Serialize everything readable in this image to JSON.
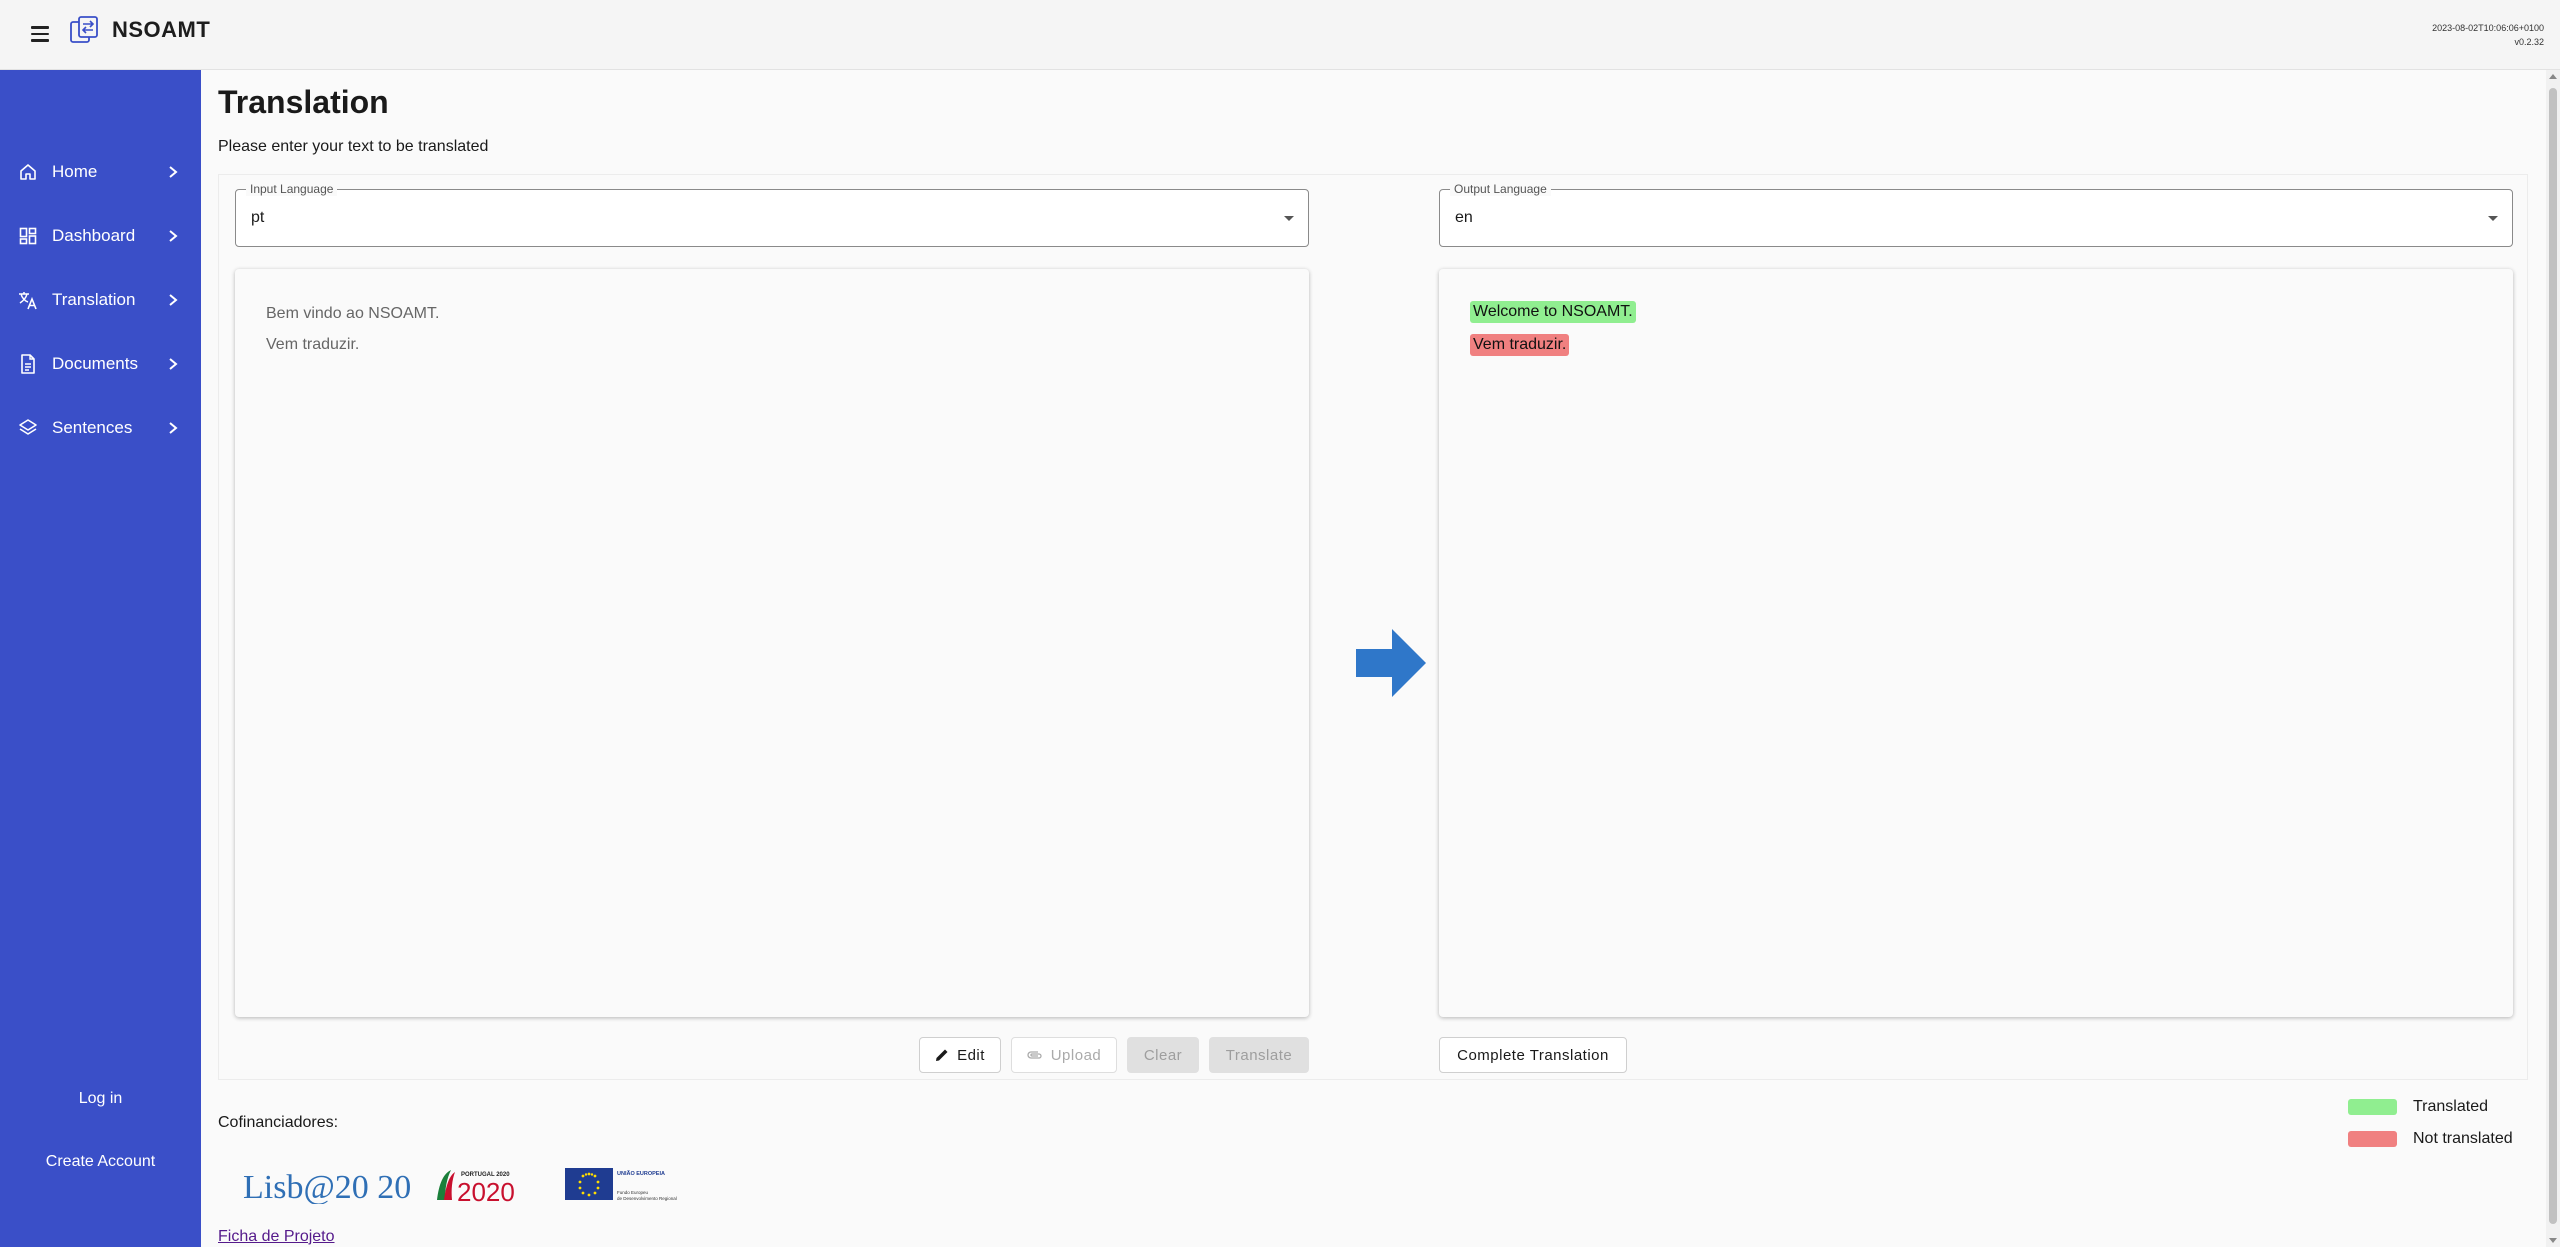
{
  "header": {
    "app_title": "NSOAMT",
    "build_timestamp": "2023-08-02T10:06:06+0100",
    "version": "v0.2.32",
    "menu_icon": "hamburger-menu-icon",
    "logo_icon": "translation-logo-icon"
  },
  "sidebar": {
    "items": [
      {
        "label": "Home",
        "icon": "home-icon"
      },
      {
        "label": "Dashboard",
        "icon": "dashboard-icon"
      },
      {
        "label": "Translation",
        "icon": "translate-icon"
      },
      {
        "label": "Documents",
        "icon": "document-icon"
      },
      {
        "label": "Sentences",
        "icon": "layers-icon"
      }
    ],
    "login": "Log in",
    "create_account": "Create Account",
    "background_color": "#3a4fc8"
  },
  "main": {
    "title": "Translation",
    "subtitle": "Please enter your text to be translated",
    "input_language": {
      "legend": "Input Language",
      "value": "pt"
    },
    "output_language": {
      "legend": "Output Language",
      "value": "en"
    },
    "source_lines": [
      "Bem vindo ao NSOAMT.",
      "Vem traduzir."
    ],
    "output_lines": [
      {
        "text": "Welcome to NSOAMT.",
        "status": "translated"
      },
      {
        "text": "Vem traduzir.",
        "status": "not_translated"
      }
    ],
    "buttons": {
      "edit": "Edit",
      "upload": "Upload",
      "clear": "Clear",
      "translate": "Translate",
      "complete_translation": "Complete Translation"
    },
    "arrow_color": "#2f77c9"
  },
  "footer": {
    "cofinanciadores": "Cofinanciadores:",
    "sponsors": {
      "lisboa": "Lisb@20 20",
      "portugal": "PORTUGAL 2020",
      "eu_title": "UNIÃO EUROPEIA",
      "eu_sub1": "Fundo Europeu",
      "eu_sub2": "de Desenvolvimento Regional"
    },
    "ficha_link": "Ficha de Projeto"
  },
  "legend": {
    "translated": {
      "label": "Translated",
      "color": "#90ee90"
    },
    "not_translated": {
      "label": "Not translated",
      "color": "#f08080"
    }
  }
}
